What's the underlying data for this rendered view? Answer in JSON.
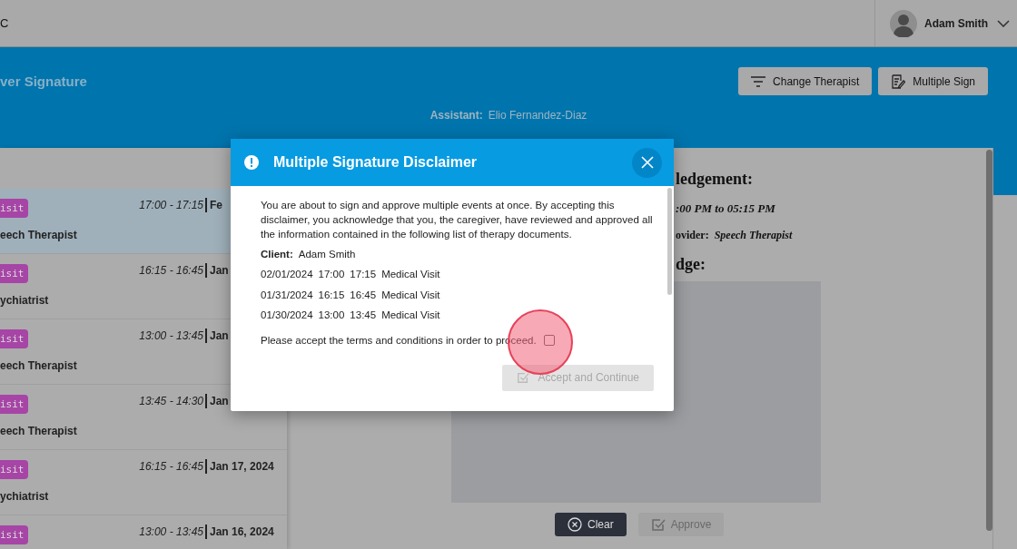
{
  "top_bar": {
    "brand": "C",
    "user": "Adam Smith"
  },
  "header": {
    "title": "ver Signature",
    "buttons": [
      {
        "label": "Change Therapist",
        "kind": "filter"
      },
      {
        "label": "Multiple Sign",
        "kind": "sign"
      }
    ],
    "assistant_label": "Assistant:",
    "assistant": "Elio Fernandez-Diaz"
  },
  "events": [
    {
      "tag": "isit",
      "provider": "eech Therapist",
      "time": "17:00 - 17:15",
      "date": "Fe",
      "selected": true
    },
    {
      "tag": "isit",
      "provider": "ychiatrist",
      "time": "16:15 - 16:45",
      "date": "Jan",
      "selected": false
    },
    {
      "tag": "isit",
      "provider": "eech Therapist",
      "time": "13:00 - 13:45",
      "date": "Jan",
      "selected": false
    },
    {
      "tag": "isit",
      "provider": "eech Therapist",
      "time": "13:45 - 14:30",
      "date": "Jan",
      "selected": false
    },
    {
      "tag": "isit",
      "provider": "ychiatrist",
      "time": "16:15 - 16:45",
      "date": "Jan 17, 2024",
      "selected": false
    },
    {
      "tag": "isit",
      "time": "13:00 - 13:45",
      "date": "Jan 16, 2024",
      "selected": false
    }
  ],
  "document": {
    "heading": "ledgement:",
    "time": ":00 PM to 05:15 PM",
    "provider_label": "ovider:",
    "provider": "Speech Therapist",
    "section": "dge:",
    "buttons": [
      {
        "label": "Clear",
        "kind": "clear",
        "disabled": false
      },
      {
        "label": "Approve",
        "kind": "approve",
        "disabled": true
      }
    ]
  },
  "modal": {
    "title": "Multiple Signature Disclaimer",
    "text": "You are about to sign and approve multiple events at once. By accepting this disclaimer, you acknowledge that you, the caregiver, have reviewed and approved all the information contained in the following list of therapy documents.",
    "client_label": "Client:",
    "client": "Adam Smith",
    "events": [
      {
        "date": "02/01/2024",
        "start": "17:00",
        "end": "17:15",
        "type": "Medical Visit"
      },
      {
        "date": "01/31/2024",
        "start": "16:15",
        "end": "16:45",
        "type": "Medical Visit"
      },
      {
        "date": "01/30/2024",
        "start": "13:00",
        "end": "13:45",
        "type": "Medical Visit"
      }
    ],
    "terms": "Please accept the terms and conditions in order to proceed.",
    "terms_checked": false,
    "button": {
      "label": "Accept and Continue",
      "disabled": true
    }
  }
}
